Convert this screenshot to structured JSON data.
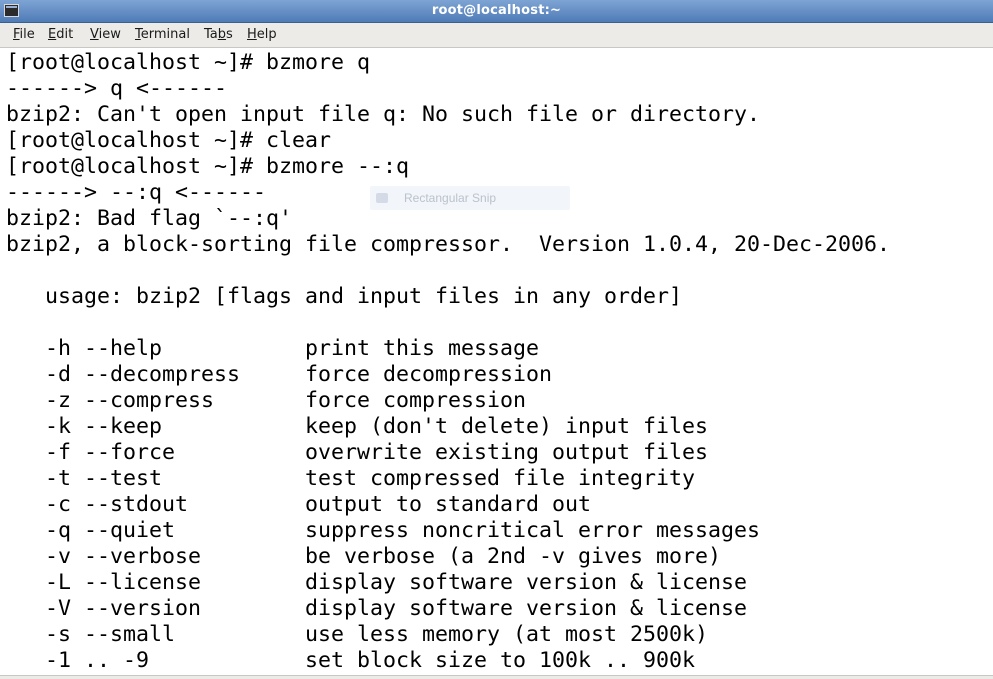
{
  "window": {
    "title": "root@localhost:~"
  },
  "menubar": {
    "items": [
      {
        "pre": "",
        "mnemonic": "F",
        "post": "ile"
      },
      {
        "pre": "",
        "mnemonic": "E",
        "post": "dit"
      },
      {
        "pre": "",
        "mnemonic": "V",
        "post": "iew"
      },
      {
        "pre": "",
        "mnemonic": "T",
        "post": "erminal"
      },
      {
        "pre": "Ta",
        "mnemonic": "b",
        "post": "s"
      },
      {
        "pre": "",
        "mnemonic": "H",
        "post": "elp"
      }
    ]
  },
  "terminal": {
    "lines": [
      "[root@localhost ~]# bzmore q",
      "------> q <------",
      "bzip2: Can't open input file q: No such file or directory.",
      "[root@localhost ~]# clear",
      "[root@localhost ~]# bzmore --:q",
      "------> --:q <------",
      "bzip2: Bad flag `--:q'",
      "bzip2, a block-sorting file compressor.  Version 1.0.4, 20-Dec-2006.",
      "",
      "   usage: bzip2 [flags and input files in any order]",
      "",
      "   -h --help           print this message",
      "   -d --decompress     force decompression",
      "   -z --compress       force compression",
      "   -k --keep           keep (don't delete) input files",
      "   -f --force          overwrite existing output files",
      "   -t --test           test compressed file integrity",
      "   -c --stdout         output to standard out",
      "   -q --quiet          suppress noncritical error messages",
      "   -v --verbose        be verbose (a 2nd -v gives more)",
      "   -L --license        display software version & license",
      "   -V --version        display software version & license",
      "   -s --small          use less memory (at most 2500k)",
      "   -1 .. -9            set block size to 100k .. 900k"
    ]
  },
  "overlay": {
    "snip_label": "Rectangular Snip"
  }
}
